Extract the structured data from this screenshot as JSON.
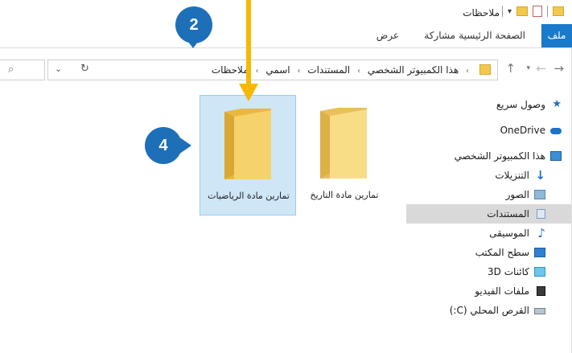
{
  "window": {
    "title": "ملاحظات"
  },
  "ribbon": {
    "tabs": [
      {
        "label": "ملف"
      },
      {
        "label": "الصفحة الرئيسية"
      },
      {
        "label": "مشاركة"
      },
      {
        "label": "عرض"
      }
    ]
  },
  "address": {
    "crumbs": [
      "هذا الكمبيوتر الشخصي",
      "المستندات",
      "اسمي",
      "ملاحظات"
    ]
  },
  "sidebar": {
    "items": [
      {
        "label": "وصول سريع",
        "icon": "star-icon"
      },
      {
        "label": "OneDrive",
        "icon": "cloud-icon"
      },
      {
        "label": "هذا الكمبيوتر الشخصي",
        "icon": "computer-icon"
      },
      {
        "label": "التنزيلات",
        "icon": "download-icon"
      },
      {
        "label": "الصور",
        "icon": "pictures-icon"
      },
      {
        "label": "المستندات",
        "icon": "documents-icon"
      },
      {
        "label": "الموسيقى",
        "icon": "music-icon"
      },
      {
        "label": "سطح المكتب",
        "icon": "desktop-icon"
      },
      {
        "label": "كائنات 3D",
        "icon": "3d-objects-icon"
      },
      {
        "label": "ملفات الفيديو",
        "icon": "video-icon"
      },
      {
        "label": "القرص المحلي (C:)",
        "icon": "drive-icon"
      }
    ]
  },
  "folders": [
    {
      "label": "تمارين مادة الرياضيات",
      "selected": true
    },
    {
      "label": "تمارين مادة التاريخ",
      "selected": false
    }
  ],
  "callouts": {
    "step_a": "2",
    "step_b": "4"
  },
  "colors": {
    "accent": "#1979ca",
    "callout": "#1d6fb8",
    "arrow": "#f6b800",
    "selection": "#cfe6f7",
    "folder": "#f2c94c"
  }
}
